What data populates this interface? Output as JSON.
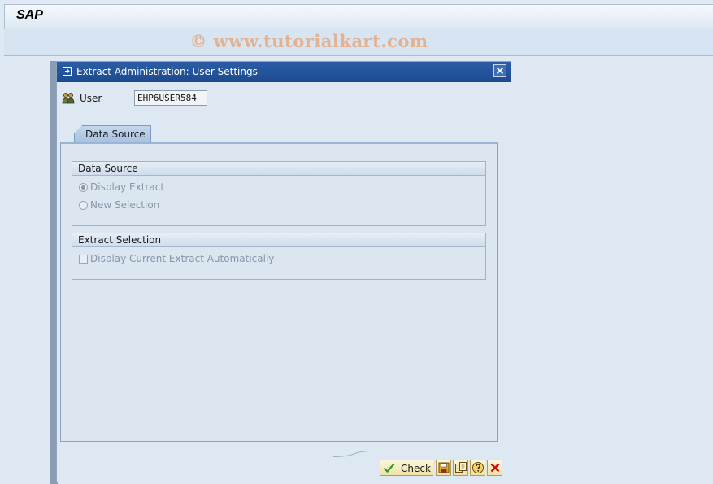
{
  "app": {
    "title": "SAP"
  },
  "watermark": "© www.tutorialkart.com",
  "dialog": {
    "title": "Extract Administration: User Settings",
    "user": {
      "label": "User",
      "value": "EHP6USER584"
    },
    "tabs": [
      {
        "label": "Data Source"
      }
    ],
    "data_source_group": {
      "title": "Data Source",
      "options": [
        {
          "label": "Display Extract",
          "selected": true
        },
        {
          "label": "New Selection",
          "selected": false
        }
      ]
    },
    "extract_selection_group": {
      "title": "Extract Selection",
      "checkbox": {
        "label": "Display Current Extract Automatically",
        "checked": false
      }
    },
    "footer": {
      "check_label": "Check"
    }
  },
  "colors": {
    "titlebar": "#1c4a8f",
    "background": "#dfe9f4",
    "button": "#efe2a5",
    "cancel_icon": "#d01010",
    "check_icon": "#2a9a2a"
  },
  "icons": [
    "dialog-title-icon",
    "close-icon",
    "user-icon",
    "check-icon",
    "save-icon",
    "copy-icon",
    "help-icon",
    "cancel-icon"
  ]
}
